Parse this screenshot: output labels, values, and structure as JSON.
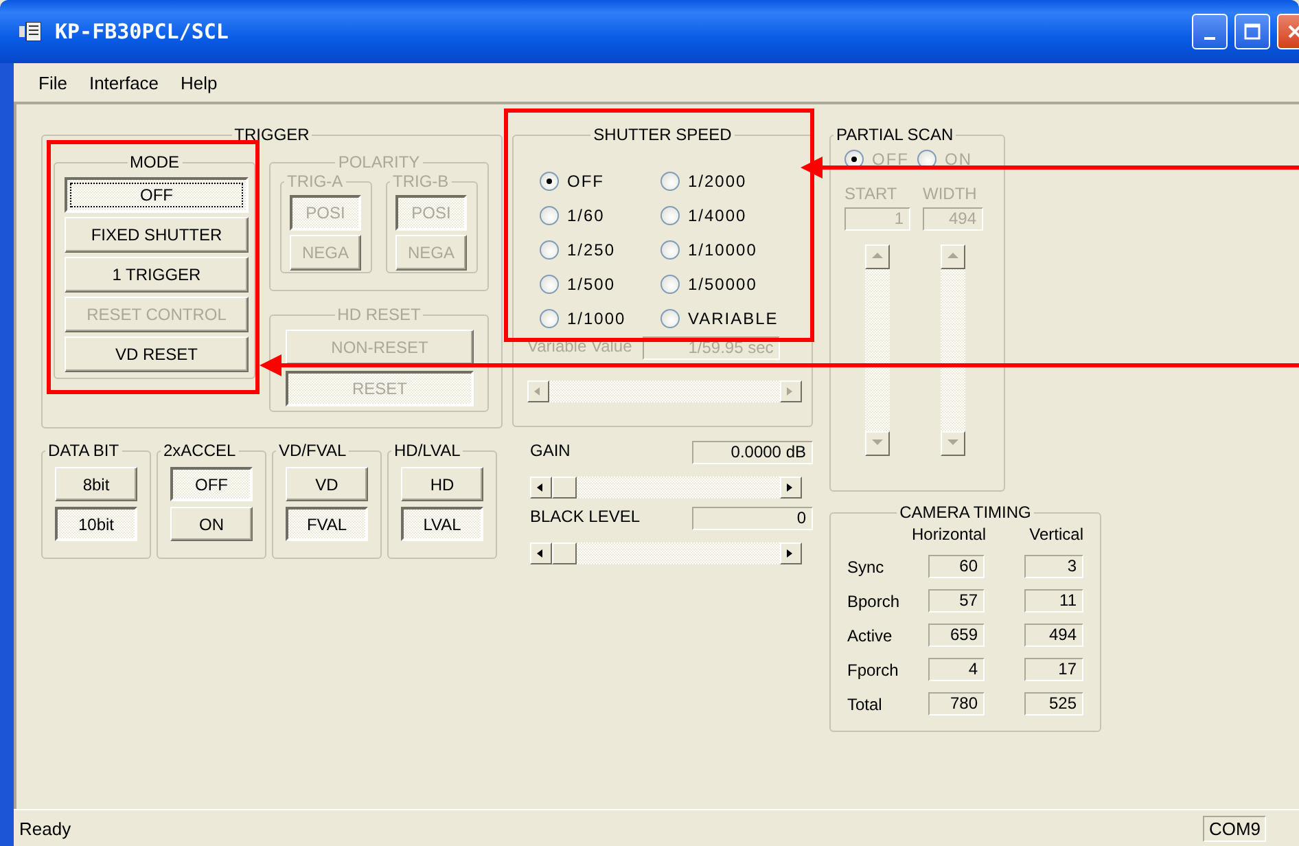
{
  "window": {
    "title": "KP-FB30PCL/SCL"
  },
  "menu": [
    "File",
    "Interface",
    "Help"
  ],
  "trigger": {
    "title": "TRIGGER",
    "mode": {
      "title": "MODE",
      "buttons": [
        {
          "label": "OFF",
          "selected": true,
          "disabled": false
        },
        {
          "label": "FIXED SHUTTER",
          "selected": false,
          "disabled": false
        },
        {
          "label": "1 TRIGGER",
          "selected": false,
          "disabled": false
        },
        {
          "label": "RESET CONTROL",
          "selected": false,
          "disabled": true
        },
        {
          "label": "VD RESET",
          "selected": false,
          "disabled": false
        }
      ]
    },
    "polarity": {
      "title": "POLARITY",
      "disabled": true,
      "groups": [
        {
          "title": "TRIG-A",
          "buttons": [
            {
              "label": "POSI",
              "selected": true
            },
            {
              "label": "NEGA",
              "selected": false
            }
          ]
        },
        {
          "title": "TRIG-B",
          "buttons": [
            {
              "label": "POSI",
              "selected": true
            },
            {
              "label": "NEGA",
              "selected": false
            }
          ]
        }
      ]
    },
    "hd_reset": {
      "title": "HD RESET",
      "disabled": true,
      "buttons": [
        {
          "label": "NON-RESET",
          "selected": false
        },
        {
          "label": "RESET",
          "selected": true
        }
      ]
    }
  },
  "toggle_groups": [
    {
      "title": "DATA BIT",
      "buttons": [
        {
          "label": "8bit",
          "selected": false
        },
        {
          "label": "10bit",
          "selected": true
        }
      ]
    },
    {
      "title": "2xACCEL",
      "buttons": [
        {
          "label": "OFF",
          "selected": true
        },
        {
          "label": "ON",
          "selected": false
        }
      ]
    },
    {
      "title": "VD/FVAL",
      "buttons": [
        {
          "label": "VD",
          "selected": false
        },
        {
          "label": "FVAL",
          "selected": true
        }
      ]
    },
    {
      "title": "HD/LVAL",
      "buttons": [
        {
          "label": "HD",
          "selected": false
        },
        {
          "label": "LVAL",
          "selected": true
        }
      ]
    }
  ],
  "shutter_speed": {
    "title": "SHUTTER SPEED",
    "options": [
      {
        "label": "OFF",
        "selected": true
      },
      {
        "label": "1/2000",
        "selected": false
      },
      {
        "label": "1/60",
        "selected": false
      },
      {
        "label": "1/4000",
        "selected": false
      },
      {
        "label": "1/250",
        "selected": false
      },
      {
        "label": "1/10000",
        "selected": false
      },
      {
        "label": "1/500",
        "selected": false
      },
      {
        "label": "1/50000",
        "selected": false
      },
      {
        "label": "1/1000",
        "selected": false
      },
      {
        "label": "VARIABLE",
        "selected": false
      }
    ],
    "variable": {
      "label": "Variable Value",
      "value": "1/59.95 sec",
      "disabled": true
    }
  },
  "sliders": [
    {
      "label": "GAIN",
      "value": "0.0000 dB",
      "level": 0
    },
    {
      "label": "BLACK LEVEL",
      "value": "0",
      "level": 0
    }
  ],
  "partial_scan": {
    "title": "PARTIAL SCAN",
    "disabled": true,
    "options": [
      {
        "label": "OFF",
        "selected": true
      },
      {
        "label": "ON",
        "selected": false
      }
    ],
    "fields": [
      {
        "label": "START",
        "value": "1"
      },
      {
        "label": "WIDTH",
        "value": "494"
      }
    ]
  },
  "camera_timing": {
    "title": "CAMERA TIMING",
    "columns": [
      "Horizontal",
      "Vertical"
    ],
    "rows": [
      {
        "label": "Sync",
        "values": [
          "60",
          "3"
        ]
      },
      {
        "label": "Bporch",
        "values": [
          "57",
          "11"
        ]
      },
      {
        "label": "Active",
        "values": [
          "659",
          "494"
        ]
      },
      {
        "label": "Fporch",
        "values": [
          "4",
          "17"
        ]
      },
      {
        "label": "Total",
        "values": [
          "780",
          "525"
        ]
      }
    ]
  },
  "status_bar": {
    "text": "Ready",
    "panel": "COM9"
  }
}
